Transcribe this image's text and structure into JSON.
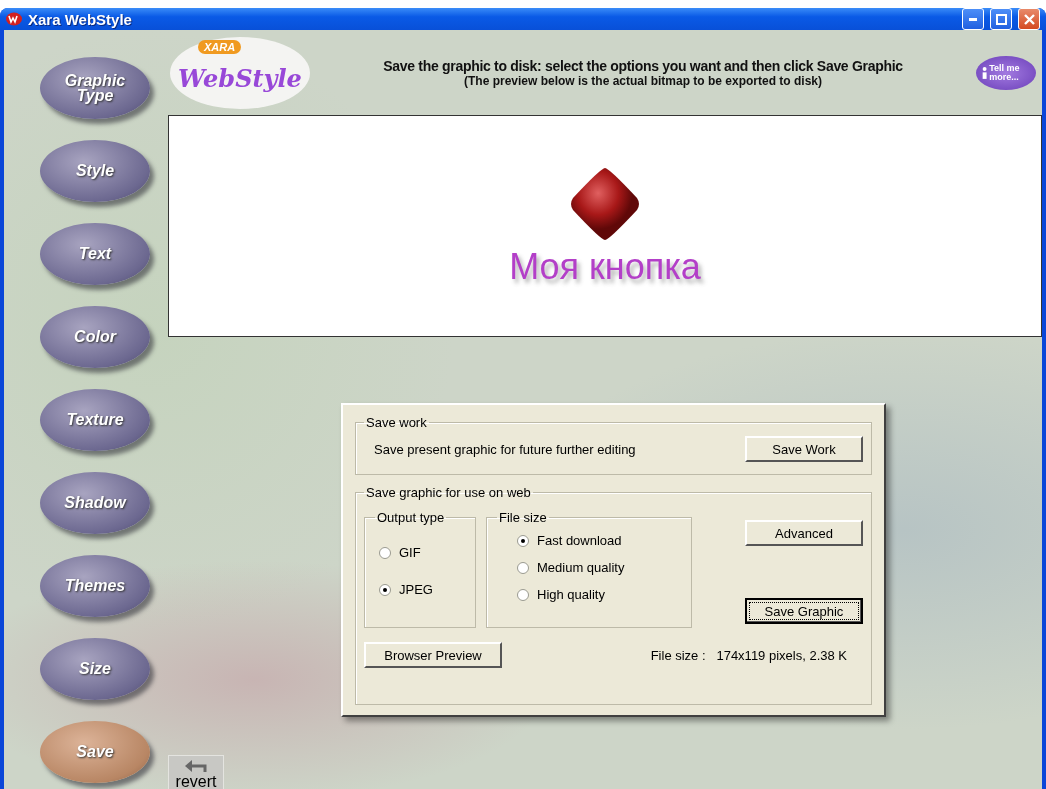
{
  "window": {
    "title": "Xara WebStyle"
  },
  "sidebar": {
    "items": [
      {
        "label": "Graphic Type",
        "selected": false
      },
      {
        "label": "Style",
        "selected": false
      },
      {
        "label": "Text",
        "selected": false
      },
      {
        "label": "Color",
        "selected": false
      },
      {
        "label": "Texture",
        "selected": false
      },
      {
        "label": "Shadow",
        "selected": false
      },
      {
        "label": "Themes",
        "selected": false
      },
      {
        "label": "Size",
        "selected": false
      },
      {
        "label": "Save",
        "selected": true
      }
    ]
  },
  "header": {
    "logo": {
      "badge": "XARA",
      "script": "WebStyle"
    },
    "instruction": "Save the graphic to disk: select the options you want and then click Save Graphic",
    "note": "(The preview below is the actual bitmap to be exported to disk)",
    "help_button": "Tell me more..."
  },
  "preview": {
    "button_text": "Моя кнопка"
  },
  "dialog": {
    "save_work": {
      "legend": "Save work",
      "description": "Save present graphic for future further editing",
      "button": {
        "label": "Save Work",
        "focused": false
      }
    },
    "save_web": {
      "legend": "Save graphic for use on web",
      "output_type": {
        "legend": "Output type",
        "options": [
          {
            "label": "GIF",
            "selected": false
          },
          {
            "label": "JPEG",
            "selected": true
          }
        ]
      },
      "file_size": {
        "legend": "File size",
        "options": [
          {
            "label": "Fast download",
            "selected": true
          },
          {
            "label": "Medium quality",
            "selected": false
          },
          {
            "label": "High quality",
            "selected": false
          }
        ]
      },
      "advanced_button": {
        "label": "Advanced",
        "focused": false
      },
      "save_button": {
        "label": "Save Graphic",
        "focused": true
      },
      "preview_button": {
        "label": "Browser Preview",
        "focused": false
      },
      "file_size_label": "File size :",
      "file_size_value": "174x119 pixels, 2.38 K"
    }
  },
  "revert_button": "revert"
}
